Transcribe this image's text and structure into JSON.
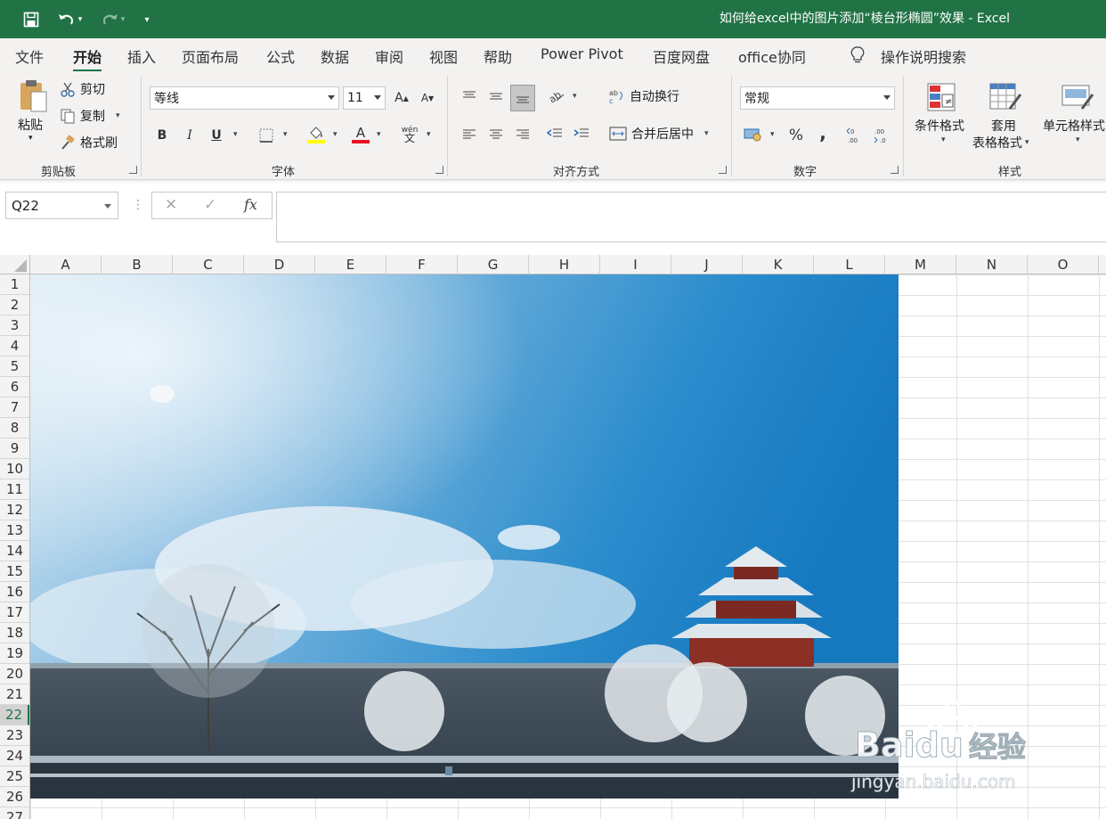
{
  "window": {
    "title": "如何给excel中的图片添加“棱台形椭圆”效果 - Excel"
  },
  "quick_access": {
    "save_icon": "save-icon",
    "undo_icon": "undo-icon",
    "redo_icon": "redo-icon",
    "customize_icon": "customize-icon"
  },
  "tabs": [
    "文件",
    "开始",
    "插入",
    "页面布局",
    "公式",
    "数据",
    "审阅",
    "视图",
    "帮助",
    "Power Pivot",
    "百度网盘",
    "office协同"
  ],
  "active_tab": "开始",
  "tell_me": "操作说明搜索",
  "ribbon": {
    "clipboard": {
      "label": "剪贴板",
      "paste": "粘贴",
      "cut": "剪切",
      "copy": "复制",
      "format_painter": "格式刷"
    },
    "font": {
      "label": "字体",
      "font_name": "等线",
      "font_size": "11",
      "bold": "B",
      "italic": "I",
      "underline": "U",
      "fill_color": "#ffff00",
      "font_color": "#e81123",
      "phonetic": "wén"
    },
    "alignment": {
      "label": "对齐方式",
      "wrap_text": "自动换行",
      "merge_center": "合并后居中"
    },
    "number": {
      "label": "数字",
      "format": "常规",
      "percent": "%",
      "comma": ","
    },
    "styles": {
      "label": "样式",
      "conditional": "条件格式",
      "table_format_1": "套用",
      "table_format_2": "表格格式",
      "cell_styles": "单元格样式"
    }
  },
  "formula_bar": {
    "name_box": "Q22",
    "fx": "fx",
    "formula": ""
  },
  "columns": [
    "A",
    "B",
    "C",
    "D",
    "E",
    "F",
    "G",
    "H",
    "I",
    "J",
    "K",
    "L",
    "M",
    "N",
    "O"
  ],
  "rows": [
    "1",
    "2",
    "3",
    "4",
    "5",
    "6",
    "7",
    "8",
    "9",
    "10",
    "11",
    "12",
    "13",
    "14",
    "15",
    "16",
    "17",
    "18",
    "19",
    "20",
    "21",
    "22",
    "23",
    "24",
    "25",
    "26",
    "27"
  ],
  "selected_row": "22",
  "watermark": {
    "text1": "Bai",
    "text2": "du",
    "text3": "经验",
    "text4": "jingyan.baidu.com"
  },
  "colors": {
    "accent": "#217346"
  }
}
